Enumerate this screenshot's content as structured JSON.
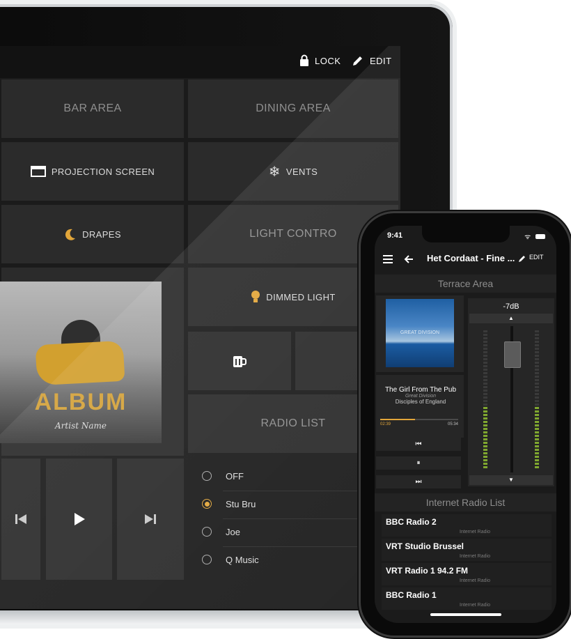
{
  "tablet": {
    "topbar": {
      "lock_label": "LOCK",
      "edit_label": "EDIT"
    },
    "tiles": {
      "bar_area": "BAR AREA",
      "dining_area": "DINING AREA",
      "projection_screen": "PROJECTION SCREEN",
      "vents": "VENTS",
      "drapes": "DRAPES",
      "light_control": "LIGHT CONTRO",
      "dimmed_light": "DIMMED LIGHT",
      "radio_list": "RADIO LIST"
    },
    "album": {
      "title": "ALBUM",
      "artist": "Artist Name"
    },
    "radio": [
      {
        "label": "OFF",
        "selected": false
      },
      {
        "label": "Stu Bru",
        "selected": true
      },
      {
        "label": "Joe",
        "selected": false
      },
      {
        "label": "Q Music",
        "selected": false
      }
    ],
    "accent_color": "#e2a63a"
  },
  "phone": {
    "time": "9:41",
    "title": "Het Cordaat - Fine ...",
    "edit_label": "EDIT",
    "section_title": "Terrace Area",
    "album_text": "GREAT DIVISION",
    "track": {
      "title": "The Girl From The Pub",
      "album": "Great Division",
      "artist": "Disciples of England",
      "elapsed": "02:39",
      "total": "05:34",
      "progress": 0.45
    },
    "volume": "-7dB",
    "list_title": "Internet Radio List",
    "stations": [
      {
        "name": "BBC Radio 2",
        "sub": "Internet Radio"
      },
      {
        "name": "VRT Studio Brussel",
        "sub": "Internet Radio"
      },
      {
        "name": "VRT Radio 1 94.2 FM",
        "sub": "Internet Radio"
      },
      {
        "name": "BBC Radio 1",
        "sub": "Internet Radio"
      }
    ]
  }
}
